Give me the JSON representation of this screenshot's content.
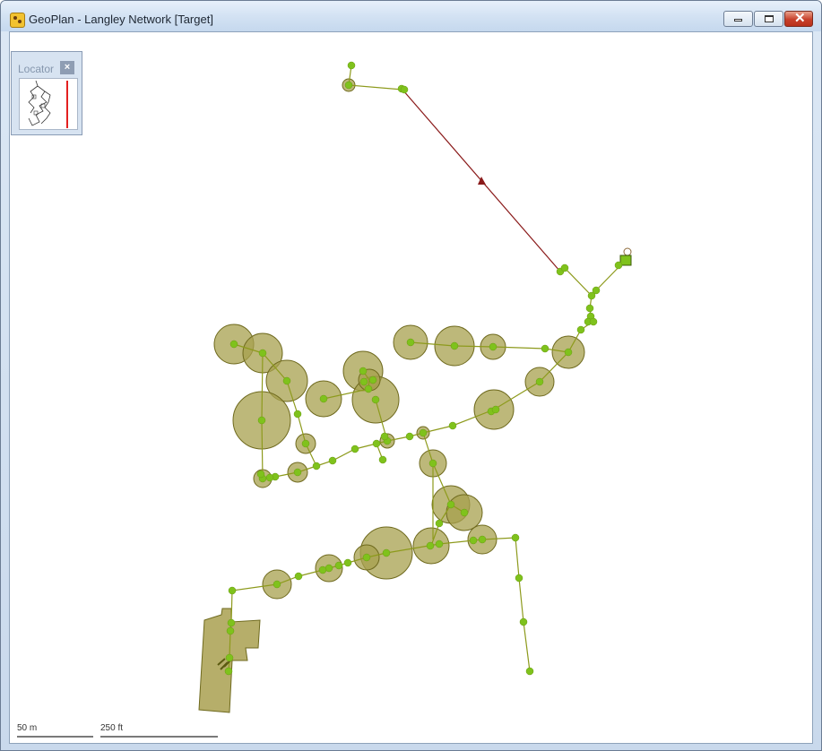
{
  "window": {
    "title": "GeoPlan - Langley Network [Target]",
    "minimize_icon": "minimize-icon",
    "maximize_icon": "restore-icon",
    "close_icon": "close-icon"
  },
  "locator": {
    "title": "Locator",
    "close_glyph": "×",
    "marker_color": "#e32020"
  },
  "map": {
    "pipe_color": "#8d9a1c",
    "node_color": "#7fc21c",
    "buffer_fill": "#a7a04e",
    "buffer_stroke": "#6f6a1e",
    "highlight_link_color": "#8a1a1a",
    "polygon_fill": "#b6ae6a"
  },
  "scale_bar": {
    "metric_label": "50 m",
    "imperial_label": "250 ft"
  }
}
